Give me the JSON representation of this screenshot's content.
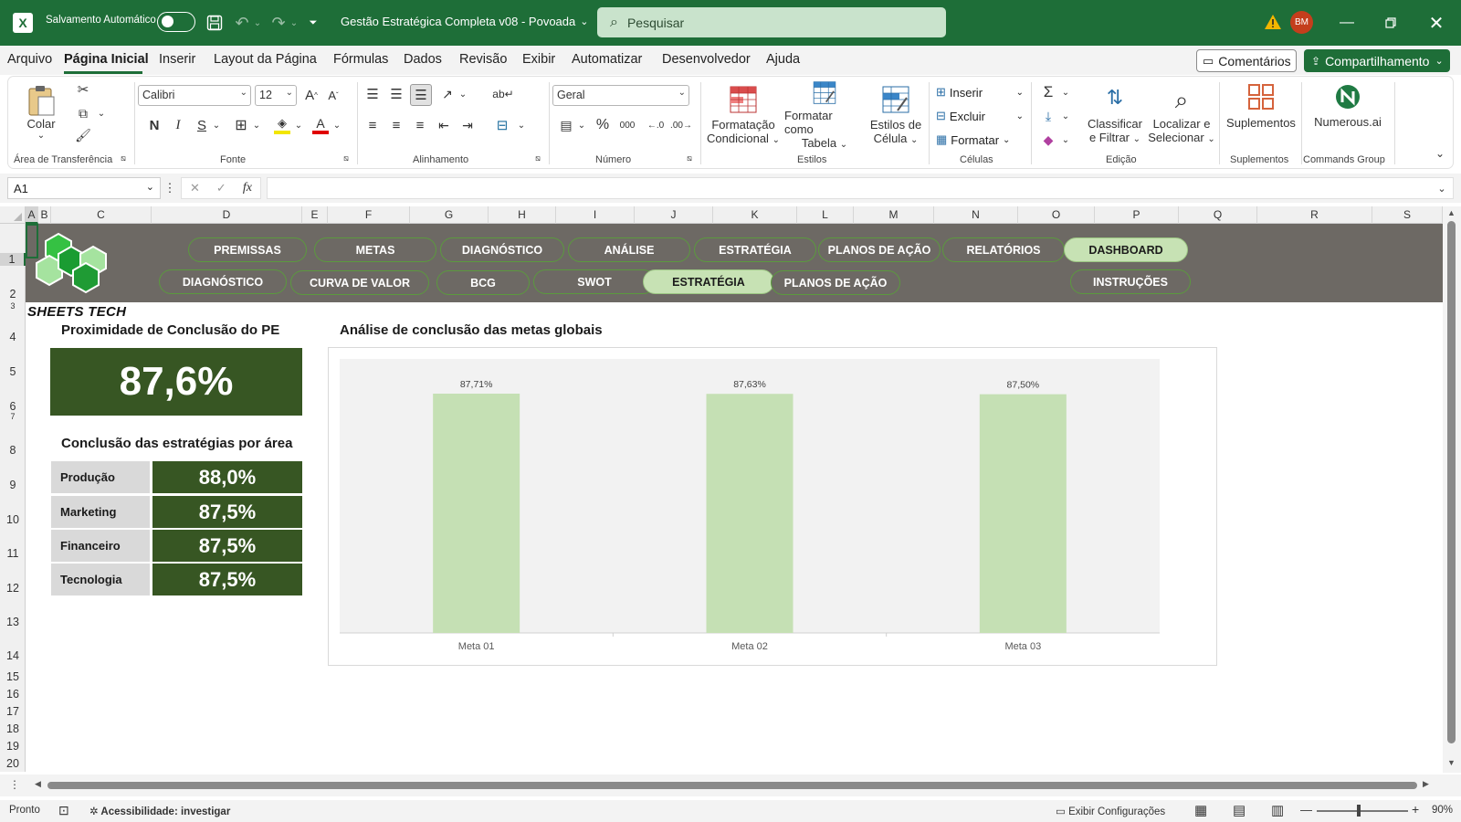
{
  "title_bar": {
    "autosave_label": "Salvamento Automático",
    "doc_title": "Gestão Estratégica Completa v08 - Povoada",
    "search_placeholder": "Pesquisar",
    "user_initials": "BM"
  },
  "menu_tabs": [
    "Arquivo",
    "Página Inicial",
    "Inserir",
    "Layout da Página",
    "Fórmulas",
    "Dados",
    "Revisão",
    "Exibir",
    "Automatizar",
    "Desenvolvedor",
    "Ajuda"
  ],
  "menu_actions": {
    "comments": "Comentários",
    "share": "Compartilhamento"
  },
  "ribbon": {
    "clipboard": {
      "paste": "Colar",
      "label": "Área de Transferência"
    },
    "font": {
      "name": "Calibri",
      "size": "12",
      "label": "Fonte",
      "bold": "N",
      "italic": "I",
      "underline": "S",
      "grow": "A^",
      "shrink": "Aˇ"
    },
    "alignment": {
      "label": "Alinhamento"
    },
    "number": {
      "format": "Geral",
      "label": "Número",
      "percent": "%",
      "thousands": "000"
    },
    "styles": {
      "cond_line1": "Formatação",
      "cond_line2": "Condicional",
      "table_line1": "Formatar como",
      "table_line2": "Tabela",
      "cell_line1": "Estilos de",
      "cell_line2": "Célula",
      "label": "Estilos"
    },
    "cells": {
      "insert": "Inserir",
      "delete": "Excluir",
      "format": "Formatar",
      "label": "Células"
    },
    "editing": {
      "sort_line1": "Classificar",
      "sort_line2": "e Filtrar",
      "find_line1": "Localizar e",
      "find_line2": "Selecionar",
      "label": "Edição"
    },
    "addins": {
      "button": "Suplementos",
      "label": "Suplementos"
    },
    "commands": {
      "button": "Numerous.ai",
      "label": "Commands Group"
    }
  },
  "formula_bar": {
    "name_box": "A1",
    "fx": "fx",
    "formula": ""
  },
  "columns": [
    "A",
    "B",
    "C",
    "D",
    "E",
    "F",
    "G",
    "H",
    "I",
    "J",
    "K",
    "L",
    "M",
    "N",
    "O",
    "P",
    "Q",
    "R",
    "S"
  ],
  "rows": [
    "1",
    "2",
    "3",
    "4",
    "5",
    "6",
    "7",
    "8",
    "9",
    "10",
    "11",
    "12",
    "13",
    "14",
    "15",
    "16",
    "17",
    "18",
    "19",
    "20"
  ],
  "nav": {
    "row1": [
      "PREMISSAS",
      "METAS",
      "DIAGNÓSTICO",
      "ANÁLISE",
      "ESTRATÉGIA",
      "PLANOS DE AÇÃO",
      "RELATÓRIOS",
      "DASHBOARD"
    ],
    "row1_active": "DASHBOARD",
    "row2": [
      "DIAGNÓSTICO",
      "CURVA DE VALOR",
      "BCG",
      "SWOT",
      "ESTRATÉGIA",
      "PLANOS DE AÇÃO",
      "INSTRUÇÕES"
    ],
    "row2_active": "ESTRATÉGIA"
  },
  "logo": {
    "text": "SHEETS TECH"
  },
  "kpi": {
    "title": "Proximidade de Conclusão do PE",
    "value": "87,6%"
  },
  "areas": {
    "title": "Conclusão das estratégias por área",
    "items": [
      {
        "name": "Produção",
        "value": "88,0%"
      },
      {
        "name": "Marketing",
        "value": "87,5%"
      },
      {
        "name": "Financeiro",
        "value": "87,5%"
      },
      {
        "name": "Tecnologia",
        "value": "87,5%"
      }
    ]
  },
  "chart_title": "Análise de conclusão das metas globais",
  "chart_data": {
    "type": "bar",
    "title": "Análise de conclusão das metas globais",
    "categories": [
      "Meta 01",
      "Meta 02",
      "Meta 03"
    ],
    "values": [
      87.71,
      87.63,
      87.5
    ],
    "data_labels": [
      "87,71%",
      "87,63%",
      "87,50%"
    ],
    "ylim": [
      0,
      87.71
    ],
    "bar_color": "#c5e0b4",
    "plot_bg": "#f2f2f2",
    "grid": false,
    "legend": "none"
  },
  "status_bar": {
    "ready": "Pronto",
    "accessibility": "Acessibilidade: investigar",
    "display_settings": "Exibir Configurações",
    "zoom": "90%"
  },
  "colors": {
    "excel_green": "#1e6e38",
    "nav_band": "#6d6964",
    "kpi_green": "#375623",
    "active_pill": "#c7e2b4"
  }
}
